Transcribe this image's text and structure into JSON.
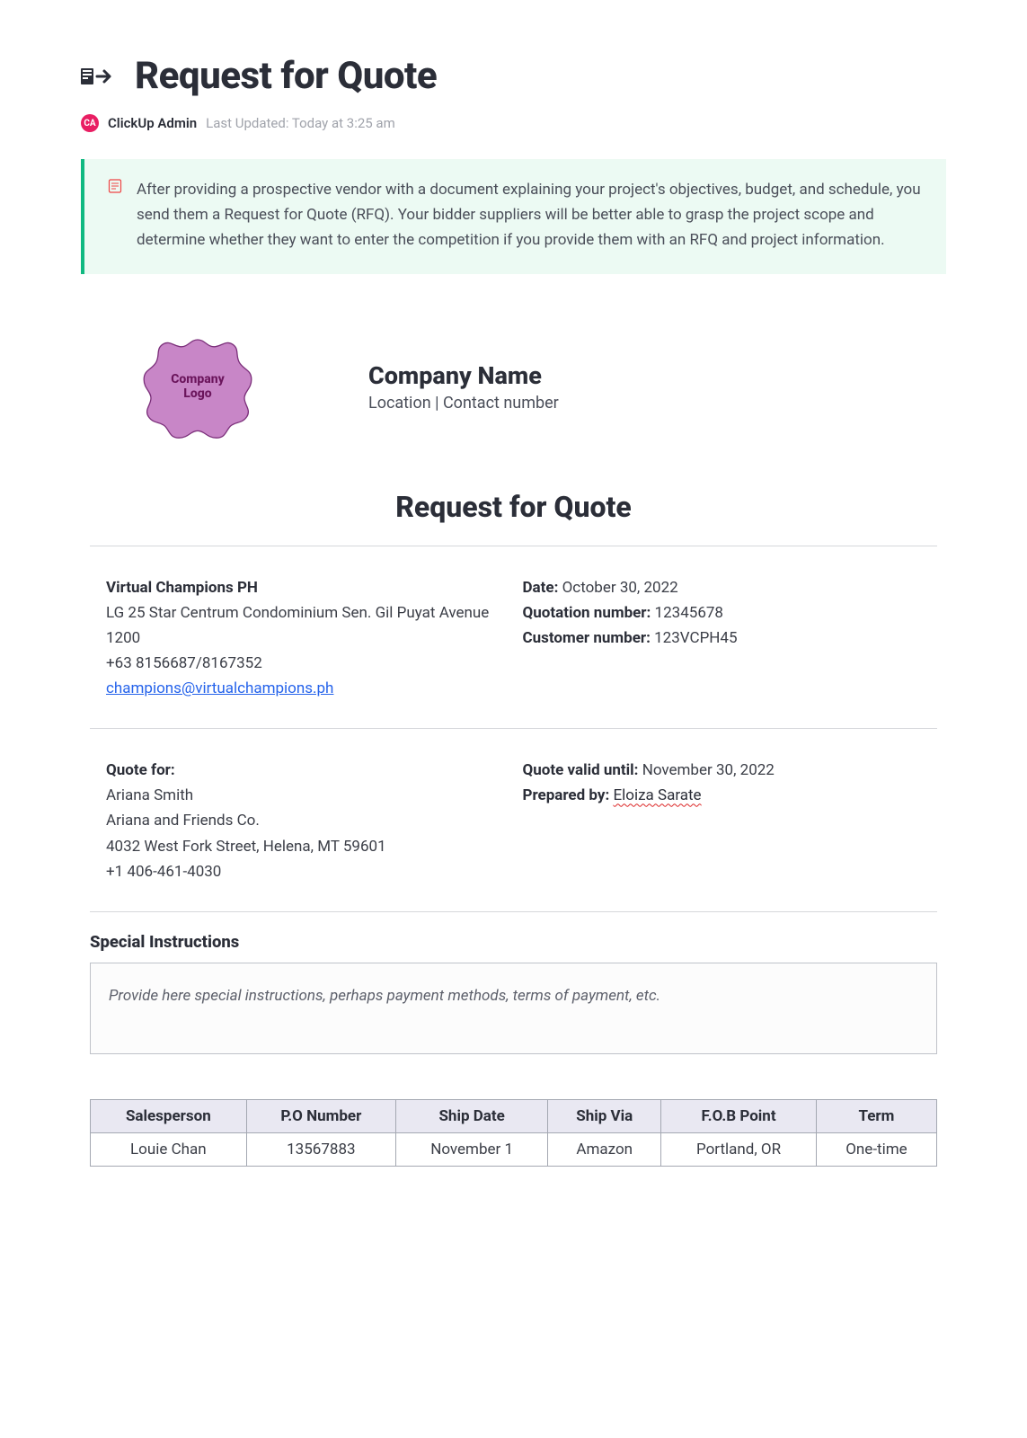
{
  "header": {
    "title": "Request for Quote",
    "avatar_text": "CA",
    "author": "ClickUp Admin",
    "updated": "Last Updated: Today at 3:25 am"
  },
  "callout": {
    "text": "After providing a prospective vendor with a document explaining your project's objectives, budget, and schedule, you send them a Request for Quote (RFQ). Your bidder suppliers will be better able to grasp the project scope and determine whether they want to enter the competition if you provide them with an RFQ and project information."
  },
  "company": {
    "logo_line1": "Company",
    "logo_line2": "Logo",
    "name": "Company Name",
    "subtitle": "Location | Contact number"
  },
  "section_title": "Request for Quote",
  "vendor": {
    "company": "Virtual Champions PH",
    "address": "LG 25 Star Centrum Condominium Sen. Gil Puyat Avenue 1200",
    "phone": "+63 8156687/8167352",
    "email": "champions@virtualchampions.ph"
  },
  "meta": {
    "date_label": "Date:",
    "date_value": "October 30, 2022",
    "quotation_label": "Quotation number:",
    "quotation_value": "12345678",
    "customer_label": "Customer number:",
    "customer_value": "123VCPH45"
  },
  "quote_for": {
    "label": "Quote for:",
    "name": "Ariana Smith",
    "company": "Ariana and Friends Co.",
    "address": "4032 West Fork Street, Helena, MT 59601",
    "phone": "+1 406-461-4030"
  },
  "validity": {
    "valid_label": "Quote valid until:",
    "valid_value": "November 30, 2022",
    "prepared_label": "Prepared by:",
    "prepared_value": "Eloiza Sarate"
  },
  "instructions": {
    "heading": "Special Instructions",
    "placeholder": "Provide here special instructions, perhaps payment methods, terms of payment, etc."
  },
  "ship_table": {
    "headers": [
      "Salesperson",
      "P.O Number",
      "Ship Date",
      "Ship Via",
      "F.O.B Point",
      "Term"
    ],
    "row": [
      "Louie Chan",
      "13567883",
      "November 1",
      "Amazon",
      "Portland, OR",
      "One-time"
    ]
  }
}
